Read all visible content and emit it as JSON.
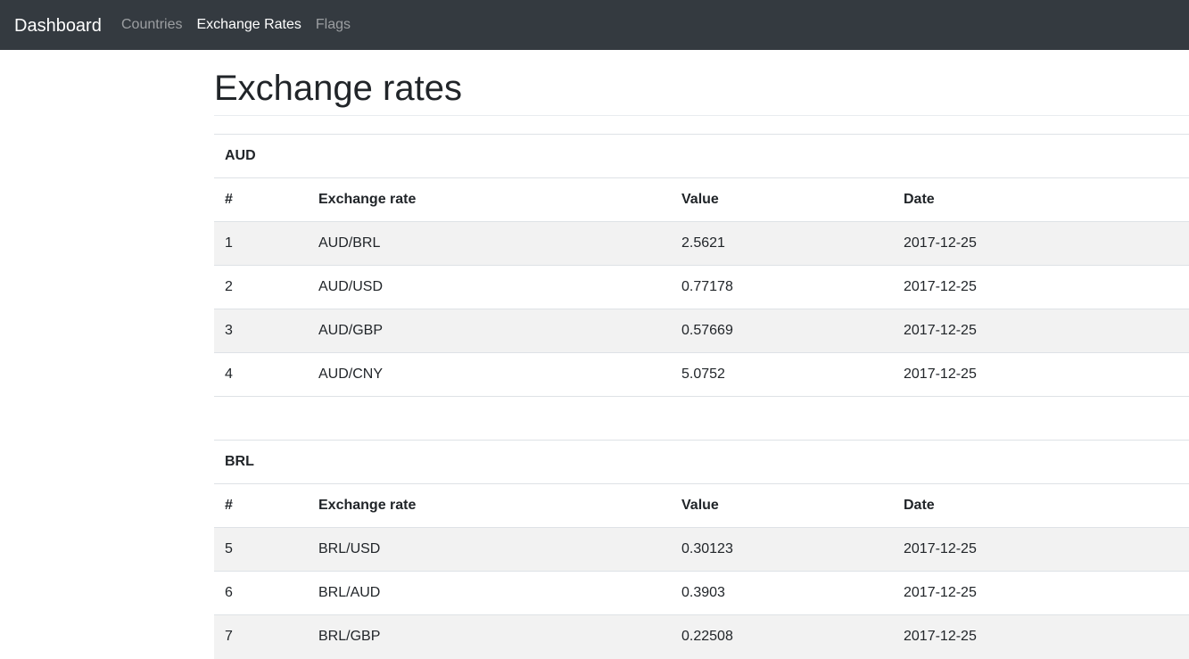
{
  "navbar": {
    "brand": "Dashboard",
    "links": [
      {
        "label": "Countries",
        "active": false
      },
      {
        "label": "Exchange Rates",
        "active": true
      },
      {
        "label": "Flags",
        "active": false
      }
    ]
  },
  "page": {
    "title": "Exchange rates"
  },
  "columns": {
    "num": "#",
    "rate": "Exchange rate",
    "value": "Value",
    "date": "Date"
  },
  "groups": [
    {
      "currency": "AUD",
      "rows": [
        {
          "num": "1",
          "rate": "AUD/BRL",
          "value": "2.5621",
          "date": "2017-12-25"
        },
        {
          "num": "2",
          "rate": "AUD/USD",
          "value": "0.77178",
          "date": "2017-12-25"
        },
        {
          "num": "3",
          "rate": "AUD/GBP",
          "value": "0.57669",
          "date": "2017-12-25"
        },
        {
          "num": "4",
          "rate": "AUD/CNY",
          "value": "5.0752",
          "date": "2017-12-25"
        }
      ]
    },
    {
      "currency": "BRL",
      "rows": [
        {
          "num": "5",
          "rate": "BRL/USD",
          "value": "0.30123",
          "date": "2017-12-25"
        },
        {
          "num": "6",
          "rate": "BRL/AUD",
          "value": "0.3903",
          "date": "2017-12-25"
        },
        {
          "num": "7",
          "rate": "BRL/GBP",
          "value": "0.22508",
          "date": "2017-12-25"
        }
      ]
    }
  ]
}
